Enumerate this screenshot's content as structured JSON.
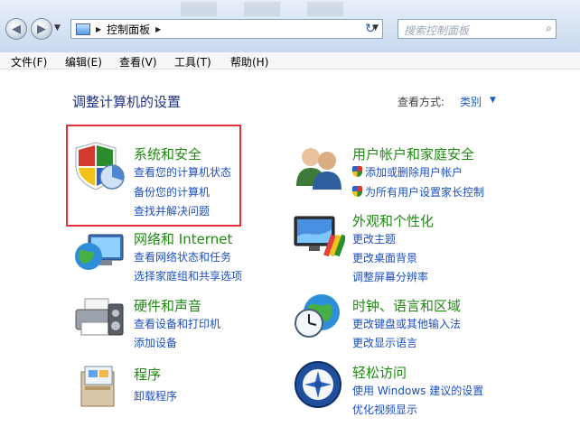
{
  "address": {
    "breadcrumb": "控制面板",
    "search_placeholder": "搜索控制面板"
  },
  "menu": [
    "文件(F)",
    "编辑(E)",
    "查看(V)",
    "工具(T)",
    "帮助(H)"
  ],
  "main": {
    "title": "调整计算机的设置",
    "view_by_label": "查看方式:",
    "view_by_value": "类别"
  },
  "categories": [
    {
      "title": "系统和安全",
      "links": [
        "查看您的计算机状态",
        "备份您的计算机",
        "查找并解决问题"
      ]
    },
    {
      "title": "网络和 Internet",
      "links": [
        "查看网络状态和任务",
        "选择家庭组和共享选项"
      ]
    },
    {
      "title": "硬件和声音",
      "links": [
        "查看设备和打印机",
        "添加设备"
      ]
    },
    {
      "title": "程序",
      "links": [
        "卸载程序"
      ]
    },
    {
      "title": "用户帐户和家庭安全",
      "links": [
        "添加或删除用户帐户",
        "为所有用户设置家长控制"
      ]
    },
    {
      "title": "外观和个性化",
      "links": [
        "更改主题",
        "更改桌面背景",
        "调整屏幕分辨率"
      ]
    },
    {
      "title": "时钟、语言和区域",
      "links": [
        "更改键盘或其他输入法",
        "更改显示语言"
      ]
    },
    {
      "title": "轻松访问",
      "links": [
        "使用 Windows 建议的设置",
        "优化视频显示"
      ]
    }
  ],
  "colors": {
    "category_title": "#1f8a12",
    "link": "#1c4fc0",
    "heading": "#1e3287",
    "highlight_border": "#e0303a"
  }
}
